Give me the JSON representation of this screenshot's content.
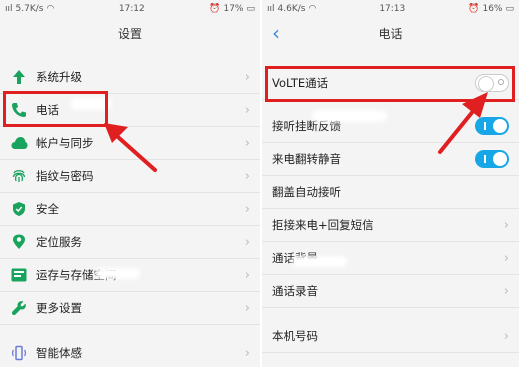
{
  "left_screen": {
    "status": {
      "carrier": "ııl",
      "speed": "5.7K/s",
      "time": "17:12",
      "battery": "17%"
    },
    "title": "设置",
    "items": [
      {
        "label": "系统升级",
        "icon": "arrow-up-icon"
      },
      {
        "label": "电话",
        "icon": "phone-icon"
      },
      {
        "label": "帐户与同步",
        "icon": "cloud-icon"
      },
      {
        "label": "指纹与密码",
        "icon": "fingerprint-icon"
      },
      {
        "label": "安全",
        "icon": "shield-icon"
      },
      {
        "label": "定位服务",
        "icon": "location-icon"
      },
      {
        "label": "运存与存储空间",
        "icon": "storage-icon"
      },
      {
        "label": "更多设置",
        "icon": "wrench-icon"
      },
      {
        "label": "智能体感",
        "icon": "phone-motion-icon"
      }
    ]
  },
  "right_screen": {
    "status": {
      "carrier": "ııl",
      "speed": "4.6K/s",
      "time": "17:13",
      "battery": "16%"
    },
    "title": "电话",
    "items": [
      {
        "label": "VoLTE通话",
        "control": "toggle",
        "state": "off"
      },
      {
        "label": "接听挂断反馈",
        "control": "toggle",
        "state": "on"
      },
      {
        "label": "来电翻转静音",
        "control": "toggle",
        "state": "on"
      },
      {
        "label": "翻盖自动接听",
        "control": "none"
      },
      {
        "label": "拒接来电+回复短信",
        "control": "chevron"
      },
      {
        "label": "通话背景",
        "control": "chevron"
      },
      {
        "label": "通话录音",
        "control": "chevron"
      },
      {
        "label": "本机号码",
        "control": "chevron"
      }
    ]
  },
  "chevron_glyph": "›",
  "back_glyph": "‹",
  "colors": {
    "highlight": "#e02020",
    "toggle_on": "#18a7e6",
    "accent_blue": "#3a8de0"
  }
}
